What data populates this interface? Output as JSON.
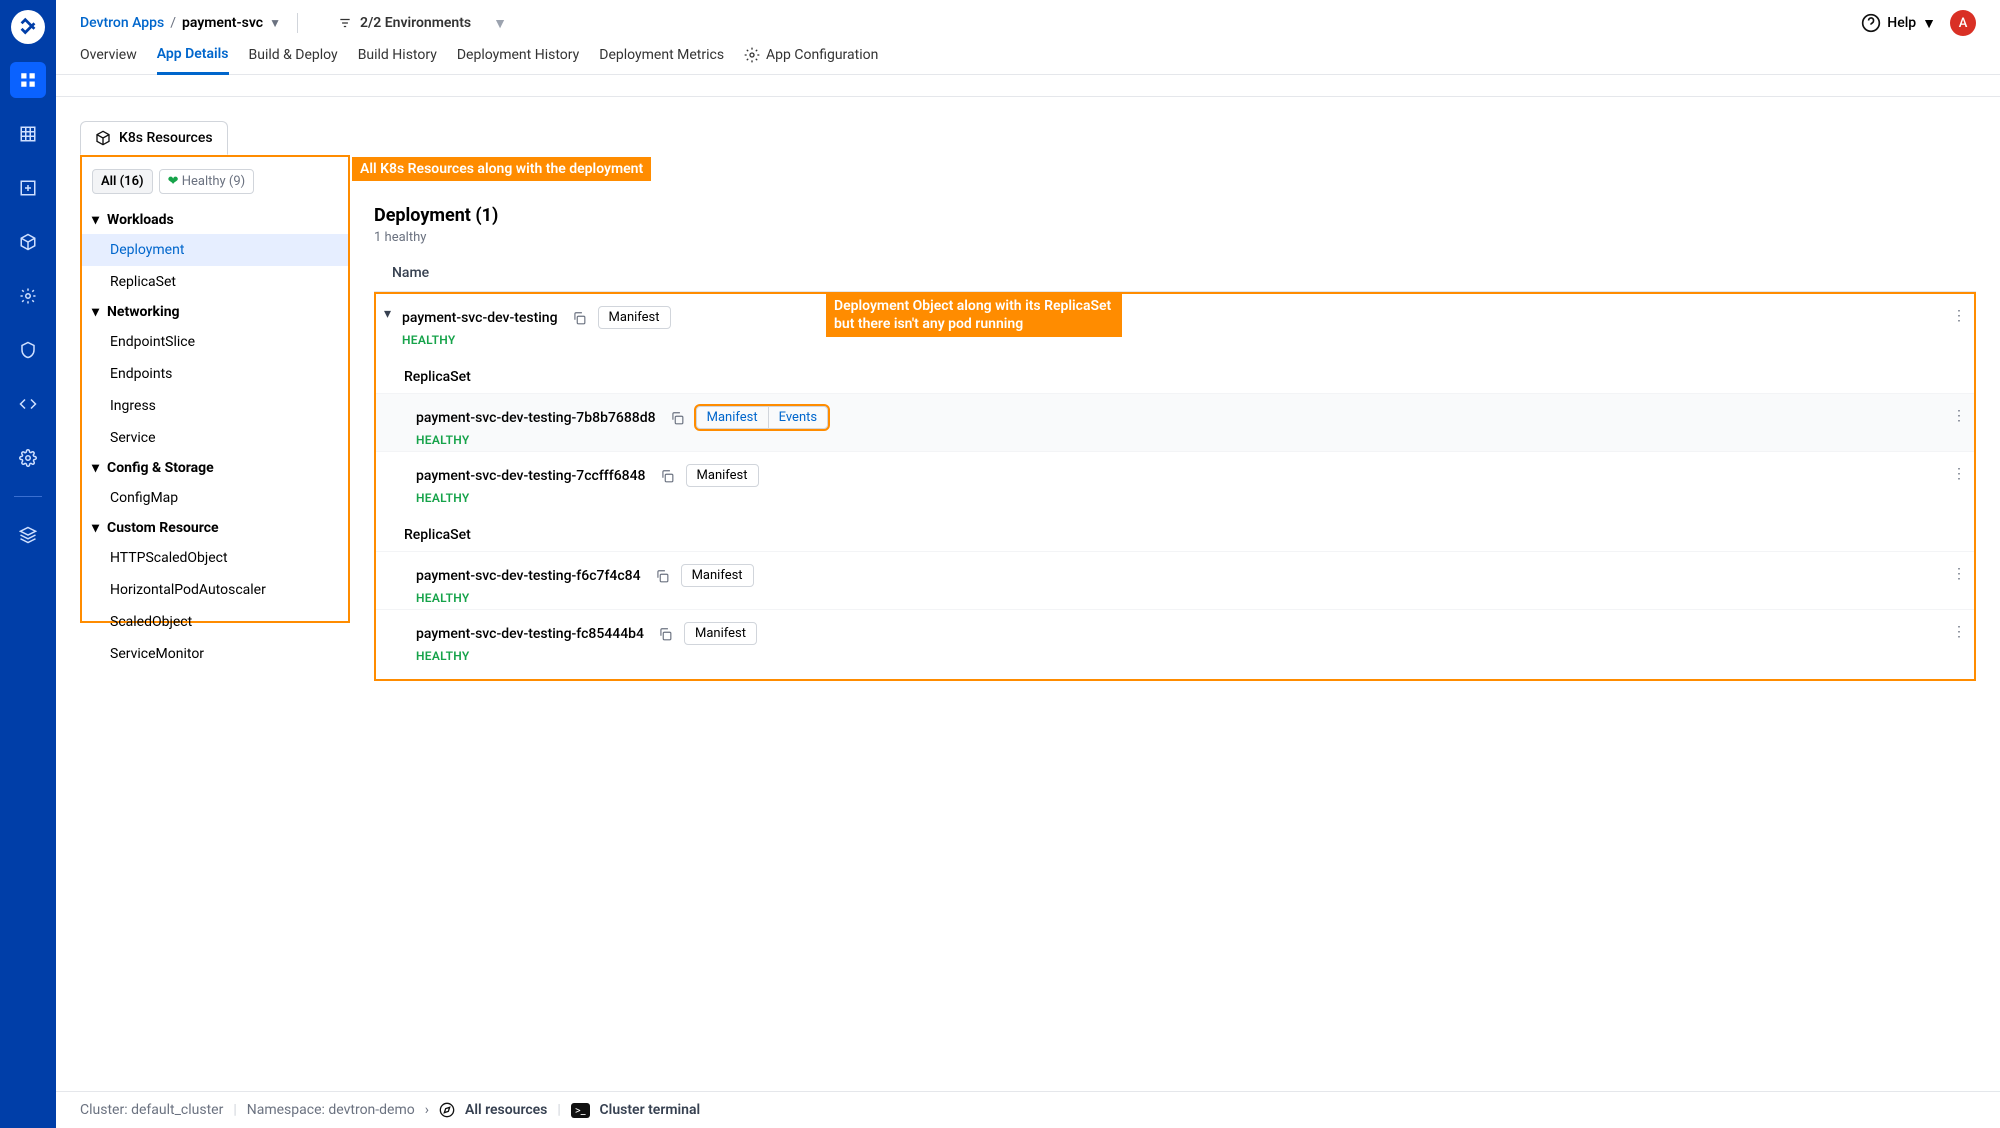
{
  "breadcrumb": {
    "root": "Devtron Apps",
    "current": "payment-svc"
  },
  "environments": "2/2 Environments",
  "help": "Help",
  "avatar": "A",
  "tabs": [
    "Overview",
    "App Details",
    "Build & Deploy",
    "Build History",
    "Deployment History",
    "Deployment Metrics",
    "App Configuration"
  ],
  "k8s_tab": "K8s Resources",
  "callout_left": "All K8s Resources along with the deployment",
  "callout_right_l1": "Deployment Object along with its ReplicaSet",
  "callout_right_l2": "but there isn't any pod running",
  "filters": {
    "all": "All (16)",
    "healthy": "Healthy (9)"
  },
  "tree": {
    "workloads": {
      "label": "Workloads",
      "items": [
        "Deployment",
        "ReplicaSet"
      ]
    },
    "networking": {
      "label": "Networking",
      "items": [
        "EndpointSlice",
        "Endpoints",
        "Ingress",
        "Service"
      ]
    },
    "config": {
      "label": "Config & Storage",
      "items": [
        "ConfigMap"
      ]
    },
    "custom": {
      "label": "Custom Resource",
      "items": [
        "HTTPScaledObject",
        "HorizontalPodAutoscaler",
        "ScaledObject",
        "ServiceMonitor"
      ]
    }
  },
  "section": {
    "title": "Deployment (1)",
    "sub": "1 healthy",
    "col_name": "Name"
  },
  "labels": {
    "manifest": "Manifest",
    "events": "Events",
    "replicaset": "ReplicaSet",
    "healthy": "HEALTHY"
  },
  "deployment": {
    "name": "payment-svc-dev-testing"
  },
  "rs1": [
    {
      "name": "payment-svc-dev-testing-7b8b7688d8",
      "hl": true
    },
    {
      "name": "payment-svc-dev-testing-7ccfff6848",
      "hl": false
    }
  ],
  "rs2": [
    {
      "name": "payment-svc-dev-testing-f6c7f4c84"
    },
    {
      "name": "payment-svc-dev-testing-fc85444b4"
    }
  ],
  "footer": {
    "cluster": "Cluster: default_cluster",
    "ns": "Namespace: devtron-demo",
    "all": "All resources",
    "term": "Cluster terminal"
  }
}
